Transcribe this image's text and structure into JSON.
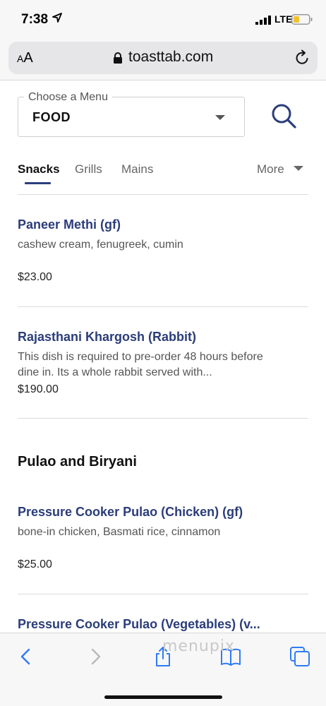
{
  "status": {
    "time": "7:38",
    "network": "LTE"
  },
  "browser": {
    "text_size_label": "AA",
    "url": "toasttab.com"
  },
  "menu_selector": {
    "label": "Choose a Menu",
    "value": "FOOD"
  },
  "tabs": [
    {
      "label": "Snacks",
      "active": true
    },
    {
      "label": "Grills",
      "active": false
    },
    {
      "label": "Mains",
      "active": false
    }
  ],
  "more_label": "More",
  "items": [
    {
      "name": "Paneer Methi (gf)",
      "description": "cashew cream, fenugreek, cumin",
      "price": "$23.00"
    },
    {
      "name": "Rajasthani Khargosh (Rabbit)",
      "description": "This dish is required to pre-order 48 hours before dine in. Its a whole rabbit served with...",
      "price": "$190.00"
    }
  ],
  "section": {
    "title": "Pulao and Biryani"
  },
  "section_items": [
    {
      "name": "Pressure Cooker Pulao (Chicken) (gf)",
      "description": "bone-in chicken, Basmati rice, cinnamon",
      "price": "$25.00"
    },
    {
      "name": "Pressure Cooker Pulao (Vegetables) (v...",
      "description": "",
      "price": ""
    }
  ],
  "watermark": "menupix",
  "colors": {
    "accent": "#2b3d7a",
    "ios_blue": "#2f7bf6"
  }
}
